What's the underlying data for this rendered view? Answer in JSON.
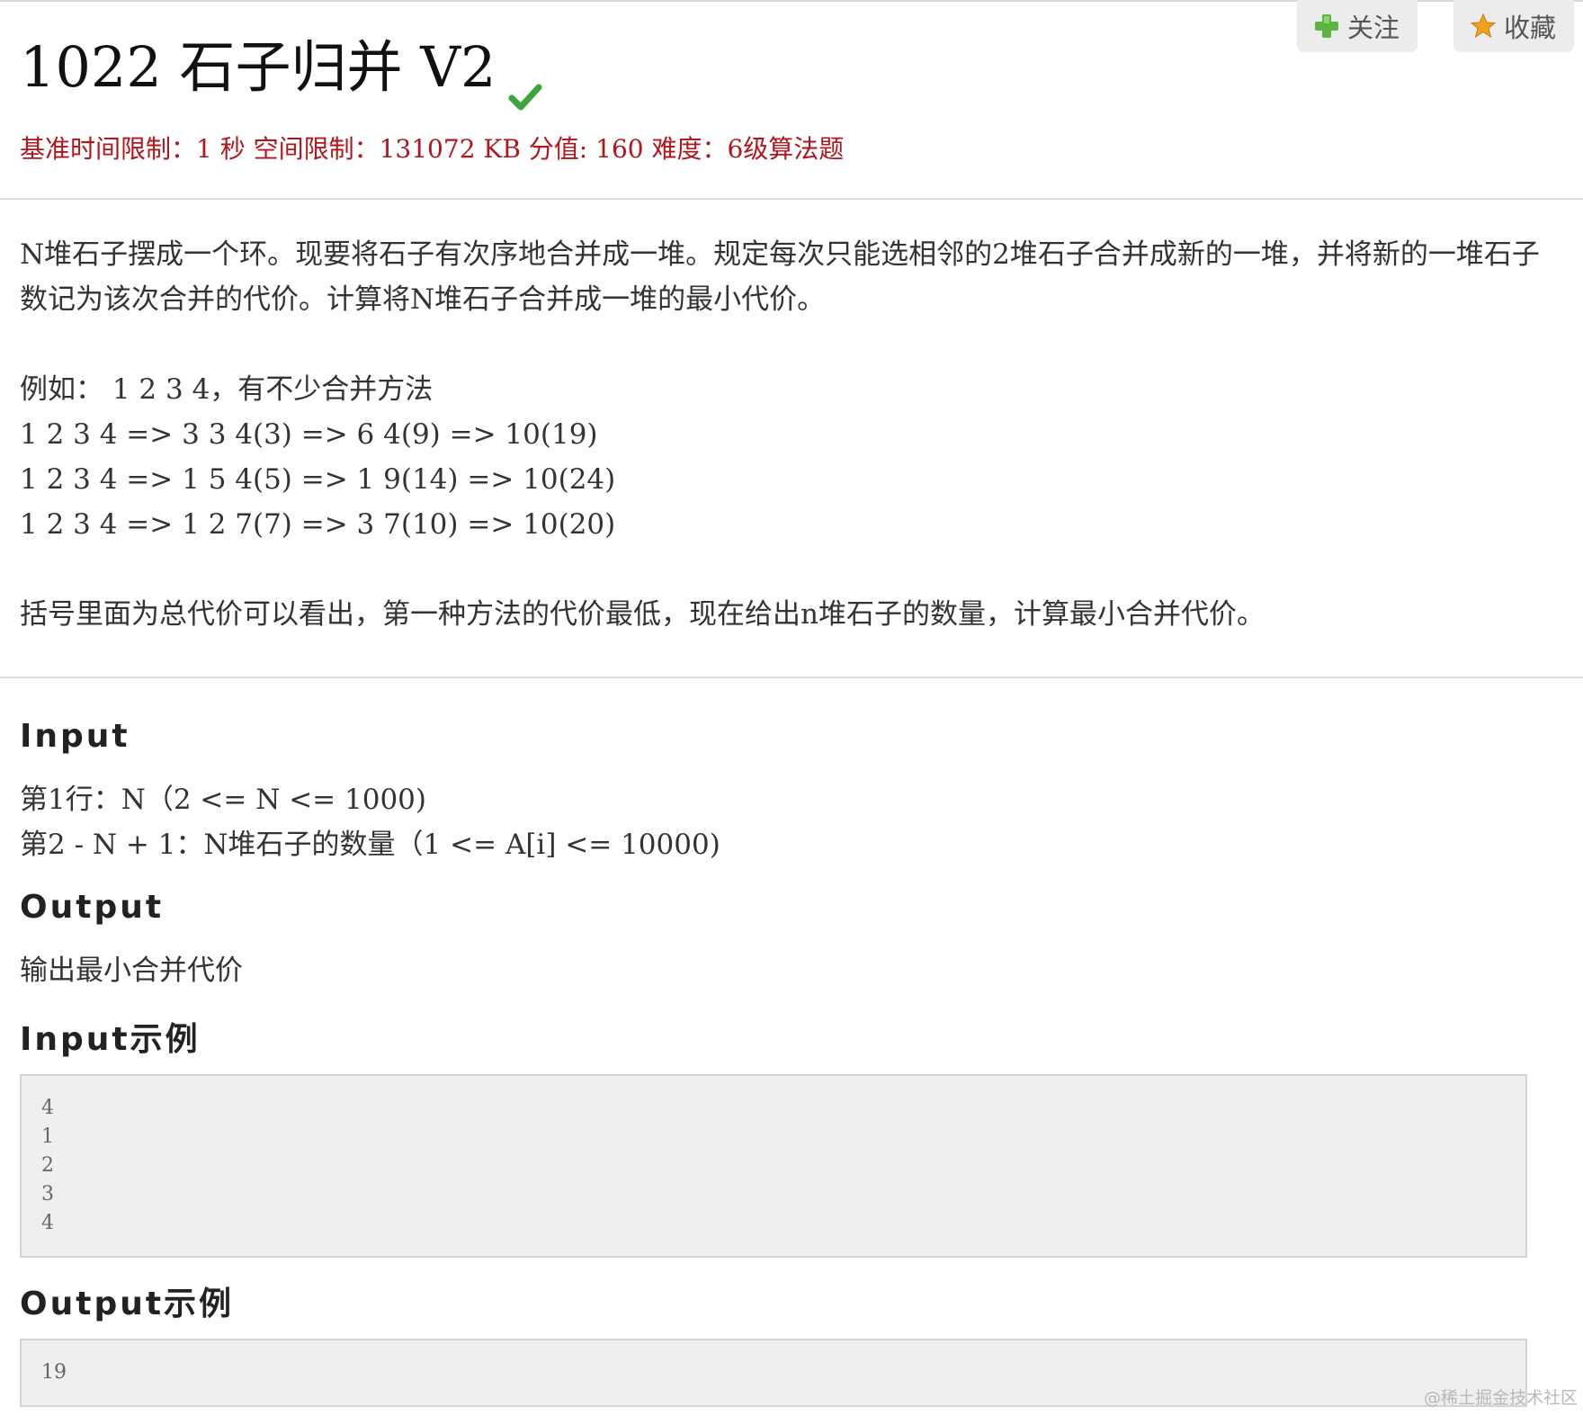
{
  "actions": {
    "follow_label": "关注",
    "favorite_label": "收藏"
  },
  "problem": {
    "title": "1022 石子归并 V2",
    "meta": "基准时间限制：1 秒 空间限制：131072 KB 分值: 160 难度：6级算法题"
  },
  "description": {
    "paragraph1": "N堆石子摆成一个环。现要将石子有次序地合并成一堆。规定每次只能选相邻的2堆石子合并成新的一堆，并将新的一堆石子数记为该次合并的代价。计算将N堆石子合并成一堆的最小代价。",
    "example_intro": "例如： 1 2 3 4，有不少合并方法",
    "example_lines": [
      "1 2 3 4 => 3 3 4(3) => 6 4(9) => 10(19)",
      "1 2 3 4 => 1 5 4(5) => 1 9(14) => 10(24)",
      "1 2 3 4 => 1 2 7(7) => 3 7(10) => 10(20)"
    ],
    "paragraph2": "括号里面为总代价可以看出，第一种方法的代价最低，现在给出n堆石子的数量，计算最小合并代价。"
  },
  "input": {
    "heading": "Input",
    "lines": [
      "第1行：N（2 <= N <= 1000)",
      "第2 - N + 1：N堆石子的数量（1 <= A[i] <= 10000)"
    ]
  },
  "output": {
    "heading": "Output",
    "text": "输出最小合并代价"
  },
  "input_example": {
    "heading": "Input示例",
    "lines": [
      "4",
      "1",
      "2",
      "3",
      "4"
    ]
  },
  "output_example": {
    "heading": "Output示例",
    "lines": [
      "19"
    ]
  },
  "watermark": "@稀土掘金技术社区",
  "icons": {
    "follow": "plus-icon",
    "favorite": "star-icon",
    "solved": "checkmark-icon"
  },
  "colors": {
    "meta_red": "#b0161c",
    "check_green": "#3aa53a",
    "plus_green": "#5bb540",
    "star_orange": "#f0a020"
  }
}
